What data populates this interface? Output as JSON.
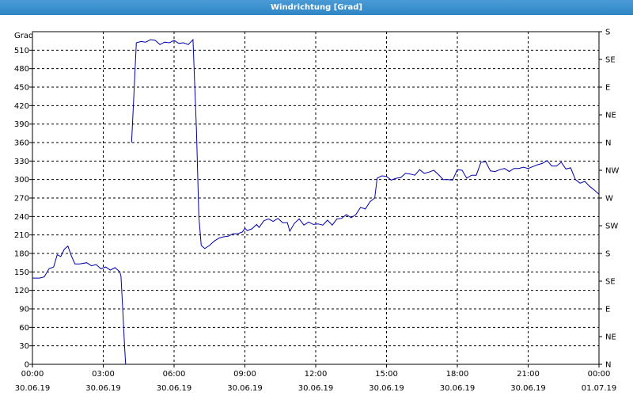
{
  "window": {
    "title": "Windrichtung [Grad]"
  },
  "chart_data": {
    "type": "line",
    "title": "Windrichtung [Grad]",
    "ylabel": "Grad",
    "ylim": [
      0,
      540
    ],
    "y_ticks": [
      0,
      30,
      60,
      90,
      120,
      150,
      180,
      210,
      240,
      270,
      300,
      330,
      360,
      390,
      420,
      450,
      480,
      510
    ],
    "y2_ticks": [
      {
        "value": 0,
        "label": "N"
      },
      {
        "value": 45,
        "label": "NE"
      },
      {
        "value": 90,
        "label": "E"
      },
      {
        "value": 135,
        "label": "SE"
      },
      {
        "value": 180,
        "label": "S"
      },
      {
        "value": 225,
        "label": "SW"
      },
      {
        "value": 270,
        "label": "W"
      },
      {
        "value": 315,
        "label": "NW"
      },
      {
        "value": 360,
        "label": "N"
      },
      {
        "value": 405,
        "label": "NE"
      },
      {
        "value": 450,
        "label": "E"
      },
      {
        "value": 495,
        "label": "SE"
      },
      {
        "value": 540,
        "label": "S"
      }
    ],
    "x_range_hours": [
      0,
      24
    ],
    "x_ticks": [
      {
        "hour": 0,
        "time": "00:00",
        "date": "30.06.19"
      },
      {
        "hour": 3,
        "time": "03:00",
        "date": "30.06.19"
      },
      {
        "hour": 6,
        "time": "06:00",
        "date": "30.06.19"
      },
      {
        "hour": 9,
        "time": "09:00",
        "date": "30.06.19"
      },
      {
        "hour": 12,
        "time": "12:00",
        "date": "30.06.19"
      },
      {
        "hour": 15,
        "time": "15:00",
        "date": "30.06.19"
      },
      {
        "hour": 18,
        "time": "18:00",
        "date": "30.06.19"
      },
      {
        "hour": 21,
        "time": "21:00",
        "date": "30.06.19"
      },
      {
        "hour": 24,
        "time": "00:00",
        "date": "01.07.19"
      }
    ],
    "grid": true,
    "series": [
      {
        "color": "#0000aa",
        "segments": [
          [
            [
              0,
              140
            ],
            [
              0.3,
              140
            ],
            [
              0.5,
              142
            ],
            [
              0.7,
              155
            ],
            [
              0.9,
              158
            ],
            [
              1.05,
              178
            ],
            [
              1.2,
              175
            ],
            [
              1.35,
              187
            ],
            [
              1.5,
              192
            ],
            [
              1.65,
              176
            ],
            [
              1.8,
              163
            ],
            [
              2.0,
              163
            ],
            [
              2.3,
              165
            ],
            [
              2.5,
              160
            ],
            [
              2.7,
              162
            ],
            [
              2.9,
              155
            ],
            [
              3.1,
              158
            ],
            [
              3.3,
              153
            ],
            [
              3.5,
              157
            ],
            [
              3.7,
              150
            ],
            [
              3.75,
              143
            ],
            [
              3.85,
              70
            ],
            [
              3.9,
              30
            ],
            [
              3.95,
              0
            ]
          ],
          [
            [
              4.2,
              360
            ],
            [
              4.3,
              440
            ],
            [
              4.4,
              522
            ],
            [
              4.6,
              524
            ],
            [
              4.8,
              523
            ],
            [
              5.0,
              527
            ],
            [
              5.2,
              526
            ],
            [
              5.4,
              519
            ],
            [
              5.6,
              523
            ],
            [
              5.8,
              522
            ],
            [
              6.0,
              526
            ],
            [
              6.2,
              521
            ],
            [
              6.4,
              522
            ],
            [
              6.6,
              519
            ],
            [
              6.8,
              527
            ],
            [
              6.95,
              380
            ],
            [
              7.05,
              240
            ],
            [
              7.15,
              193
            ],
            [
              7.3,
              188
            ],
            [
              7.5,
              193
            ],
            [
              7.7,
              200
            ],
            [
              7.9,
              205
            ],
            [
              8.1,
              207
            ],
            [
              8.3,
              208
            ],
            [
              8.5,
              212
            ],
            [
              8.7,
              212
            ],
            [
              8.9,
              215
            ],
            [
              9.0,
              221
            ],
            [
              9.1,
              217
            ],
            [
              9.3,
              220
            ],
            [
              9.5,
              227
            ],
            [
              9.6,
              222
            ],
            [
              9.8,
              233
            ],
            [
              10.0,
              236
            ],
            [
              10.2,
              232
            ],
            [
              10.4,
              237
            ],
            [
              10.6,
              230
            ],
            [
              10.8,
              230
            ],
            [
              10.9,
              216
            ],
            [
              11.1,
              229
            ],
            [
              11.3,
              236
            ],
            [
              11.5,
              226
            ],
            [
              11.7,
              231
            ],
            [
              11.9,
              227
            ],
            [
              12.1,
              228
            ],
            [
              12.3,
              226
            ],
            [
              12.5,
              234
            ],
            [
              12.7,
              226
            ],
            [
              12.9,
              236
            ],
            [
              13.1,
              237
            ],
            [
              13.3,
              243
            ],
            [
              13.5,
              238
            ],
            [
              13.7,
              243
            ],
            [
              13.9,
              255
            ],
            [
              14.1,
              252
            ],
            [
              14.3,
              264
            ],
            [
              14.5,
              270
            ],
            [
              14.6,
              302
            ],
            [
              14.8,
              306
            ],
            [
              15.0,
              305
            ],
            [
              15.2,
              299
            ],
            [
              15.4,
              302
            ],
            [
              15.6,
              303
            ],
            [
              15.8,
              310
            ],
            [
              16.0,
              309
            ],
            [
              16.2,
              307
            ],
            [
              16.4,
              316
            ],
            [
              16.6,
              310
            ],
            [
              16.8,
              312
            ],
            [
              17.0,
              315
            ],
            [
              17.2,
              308
            ],
            [
              17.4,
              300
            ],
            [
              17.6,
              300
            ],
            [
              17.8,
              299
            ],
            [
              18.0,
              316
            ],
            [
              18.2,
              315
            ],
            [
              18.4,
              302
            ],
            [
              18.6,
              307
            ],
            [
              18.8,
              307
            ],
            [
              19.0,
              328
            ],
            [
              19.2,
              329
            ],
            [
              19.4,
              314
            ],
            [
              19.6,
              313
            ],
            [
              19.8,
              316
            ],
            [
              20.0,
              318
            ],
            [
              20.2,
              313
            ],
            [
              20.4,
              318
            ],
            [
              20.6,
              318
            ],
            [
              20.8,
              320
            ],
            [
              21.0,
              318
            ],
            [
              21.2,
              321
            ],
            [
              21.4,
              324
            ],
            [
              21.6,
              326
            ],
            [
              21.8,
              331
            ],
            [
              22.0,
              322
            ],
            [
              22.2,
              322
            ],
            [
              22.4,
              328
            ],
            [
              22.6,
              317
            ],
            [
              22.8,
              319
            ],
            [
              23.0,
              300
            ],
            [
              23.2,
              294
            ],
            [
              23.4,
              297
            ],
            [
              23.6,
              289
            ],
            [
              23.8,
              283
            ],
            [
              24.0,
              276
            ]
          ]
        ]
      }
    ]
  }
}
